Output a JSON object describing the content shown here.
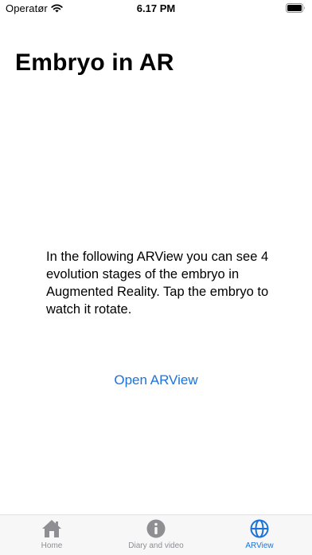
{
  "status_bar": {
    "carrier": "Operatør",
    "time": "6.17 PM"
  },
  "page": {
    "title": "Embryo in AR",
    "description": "In the following ARView you can see 4 evolution stages of the embryo in Augmented Reality. Tap the embryo to watch it rotate.",
    "open_button_label": "Open ARView"
  },
  "tab_bar": {
    "tabs": [
      {
        "label": "Home",
        "icon": "house-icon",
        "active": false
      },
      {
        "label": "Diary and video",
        "icon": "info-circle-icon",
        "active": false
      },
      {
        "label": "ARView",
        "icon": "globe-icon",
        "active": true
      }
    ]
  },
  "colors": {
    "accent": "#1a73d9",
    "inactive": "#8e8e93"
  }
}
